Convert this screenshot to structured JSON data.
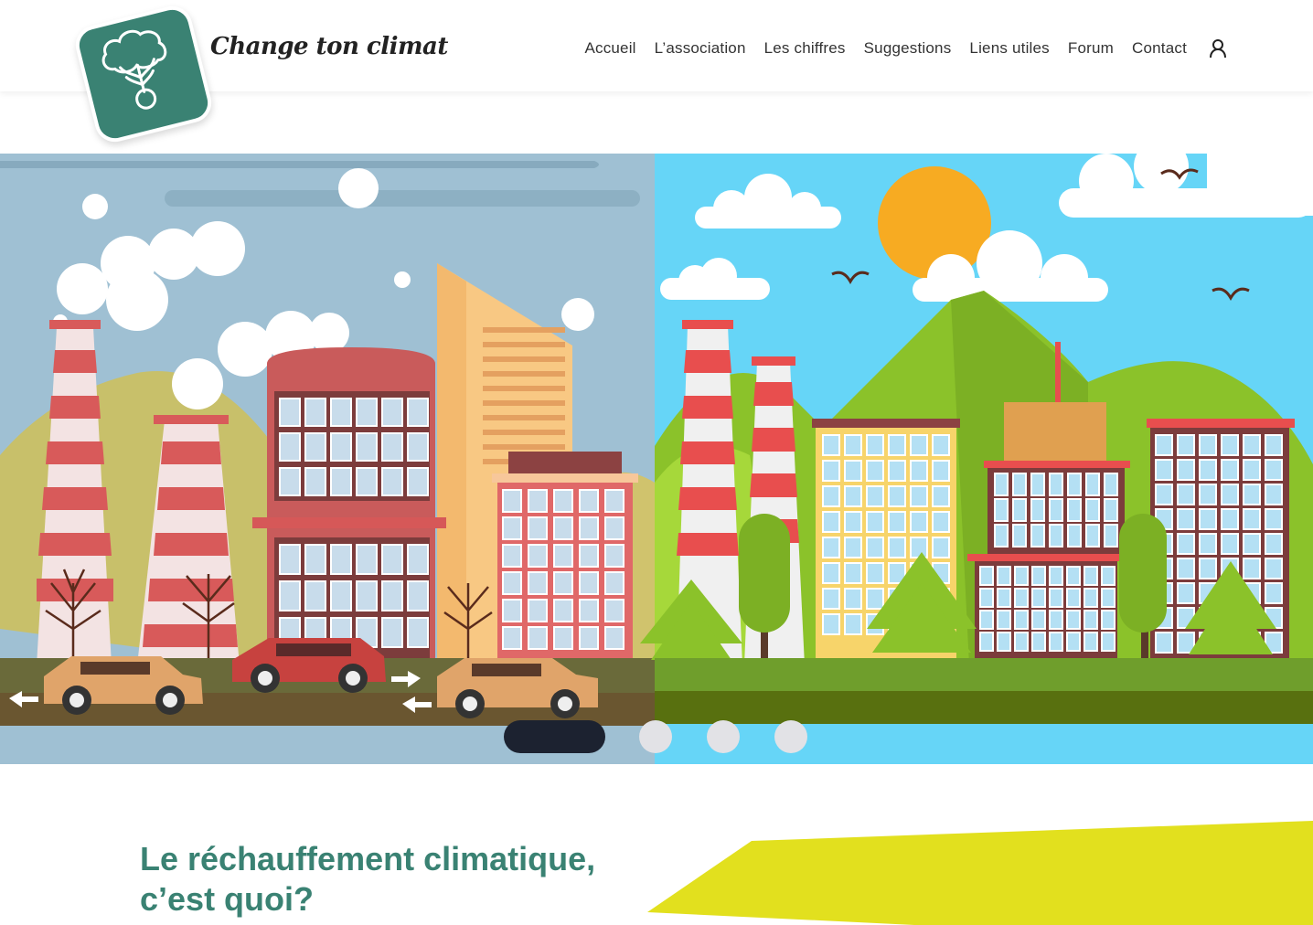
{
  "brand": {
    "name": "Change ton climat",
    "logo_icon": "tree-logo-icon",
    "color": "#3a8273"
  },
  "nav": {
    "items": [
      {
        "label": "Accueil"
      },
      {
        "label": "L’association"
      },
      {
        "label": "Les chiffres"
      },
      {
        "label": "Suggestions"
      },
      {
        "label": "Liens utiles"
      },
      {
        "label": "Forum"
      },
      {
        "label": "Contact"
      }
    ],
    "account_icon": "user-icon"
  },
  "hero": {
    "illustration": "polluted-city-vs-green-city-illustration",
    "carousel": {
      "slides": 4,
      "active": 1
    }
  },
  "section": {
    "title_line1": "Le réchauffement climatique,",
    "title_line2": "c’est quoi?"
  },
  "colors": {
    "accent_green": "#3a8273",
    "accent_yellow": "#e2e01e",
    "dark": "#1c2230"
  }
}
